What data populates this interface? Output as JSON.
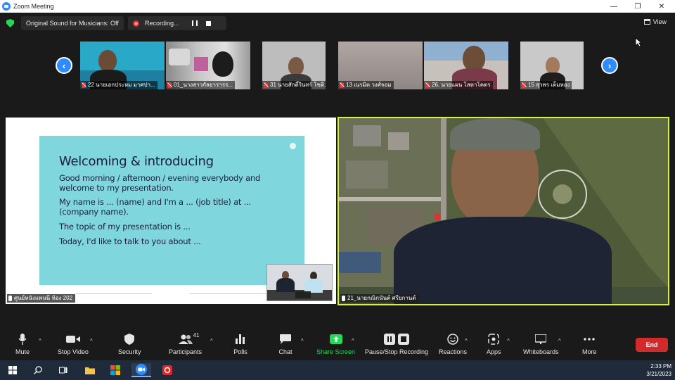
{
  "window": {
    "title": "Zoom Meeting"
  },
  "infobar": {
    "original_sound": "Original Sound for Musicians: Off",
    "recording": "Recording...",
    "view": "View"
  },
  "thumbnails": [
    {
      "name": "22 นายเอกประหม มาศปา...",
      "bg": "#2aa8c8"
    },
    {
      "name": "01_นางสาวกัลยารารร...",
      "bg": "#6d6f77"
    },
    {
      "name": "31 นายสักดิ์รินทร์  โชติ...",
      "bg": "#b6b6b6"
    },
    {
      "name": "13 เนรมิต  วงศ์จอม",
      "bg": "#9b9b9b"
    },
    {
      "name": "26. นายแผน  โสดาโคตร",
      "bg": "#9bb1c8"
    },
    {
      "name": "15 สุวพร เต็มหอง",
      "bg": "#c8c8c8"
    }
  ],
  "share": {
    "slide_title": "Welcoming & introducing",
    "line1": "Good morning / afternoon / evening everybody and welcome to my presentation.",
    "line2": "My name is ... (name) and I'm a ... (job title) at ... (company name).",
    "line3": "The topic of my presentation is ...",
    "line4": "Today, I'd like to talk to you about ...",
    "presenter_name": "ศูนย์หนังแพนนี ห้อง 202"
  },
  "speaker": {
    "name": "21_นายกณิกนันต์ ศรียกานต์"
  },
  "toolbar": {
    "mute": "Mute",
    "stop_video": "Stop Video",
    "security": "Security",
    "participants": "Participants",
    "participants_count": "41",
    "polls": "Polls",
    "chat": "Chat",
    "share_screen": "Share Screen",
    "pause_recording": "Pause/Stop Recording",
    "reactions": "Reactions",
    "apps": "Apps",
    "whiteboards": "Whiteboards",
    "more": "More",
    "end": "End"
  },
  "taskbar": {
    "time": "2:33 PM",
    "date": "3/21/2023"
  },
  "colors": {
    "accent": "#2d8cff",
    "speaker_border": "#d6f33b",
    "end": "#d12a2a",
    "share_green": "#23d959"
  }
}
